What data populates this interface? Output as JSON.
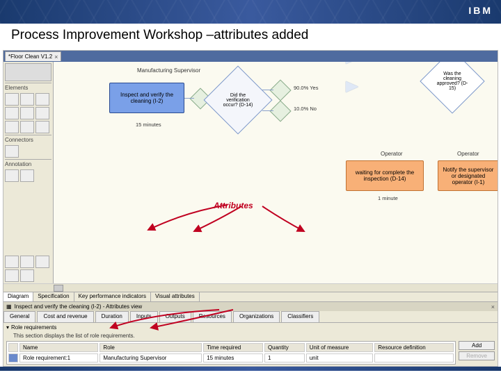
{
  "header": {
    "logo_text": "IBM"
  },
  "title": "Process Improvement Workshop –attributes added",
  "doc_tab": {
    "label": "*Floor Clean V1.2",
    "close": "×"
  },
  "palette": {
    "section_elements": "Elements",
    "section_connectors": "Connectors",
    "section_annotation": "Annotation"
  },
  "lanes": {
    "lane1": "Manufacturing Supervisor",
    "lane2": "Operator",
    "lane3": "Operator"
  },
  "nodes": {
    "task_inspect": "Inspect and verify the cleaning\n(I-2)",
    "task_inspect_time": "15 minutes",
    "decision_verify": "Did the verification occur?\n(D-14)",
    "branch_yes": "90.0% Yes",
    "branch_no": "10.0% No",
    "decision_approved": "Was the cleaning approved?\n(D-15)",
    "task_waiting": "waiting for complete the inspection\n(D-14)",
    "task_waiting_time": "1 minute",
    "task_notify": "Notify the supervisor or designated operator\n(I-1)"
  },
  "callout": "Attributes",
  "lower_tabs": [
    "Diagram",
    "Specification",
    "Key performance indicators",
    "Visual attributes"
  ],
  "prop_header": "Inspect and verify the cleaning (I-2) - Attributes view",
  "sub_tabs": [
    "General",
    "Cost and revenue",
    "Duration",
    "Inputs",
    "Outputs",
    "Resources",
    "Organizations",
    "Classifiers"
  ],
  "section_title": "Role requirements",
  "section_help": "This section displays the list of role requirements.",
  "table": {
    "headers": [
      "Name",
      "Role",
      "Time required",
      "Quantity",
      "Unit of measure",
      "Resource definition"
    ],
    "row": [
      "Role requirement:1",
      "Manufacturing Supervisor",
      "15 minutes",
      "1",
      "unit",
      ""
    ]
  },
  "buttons": {
    "add": "Add",
    "remove": "Remove"
  }
}
